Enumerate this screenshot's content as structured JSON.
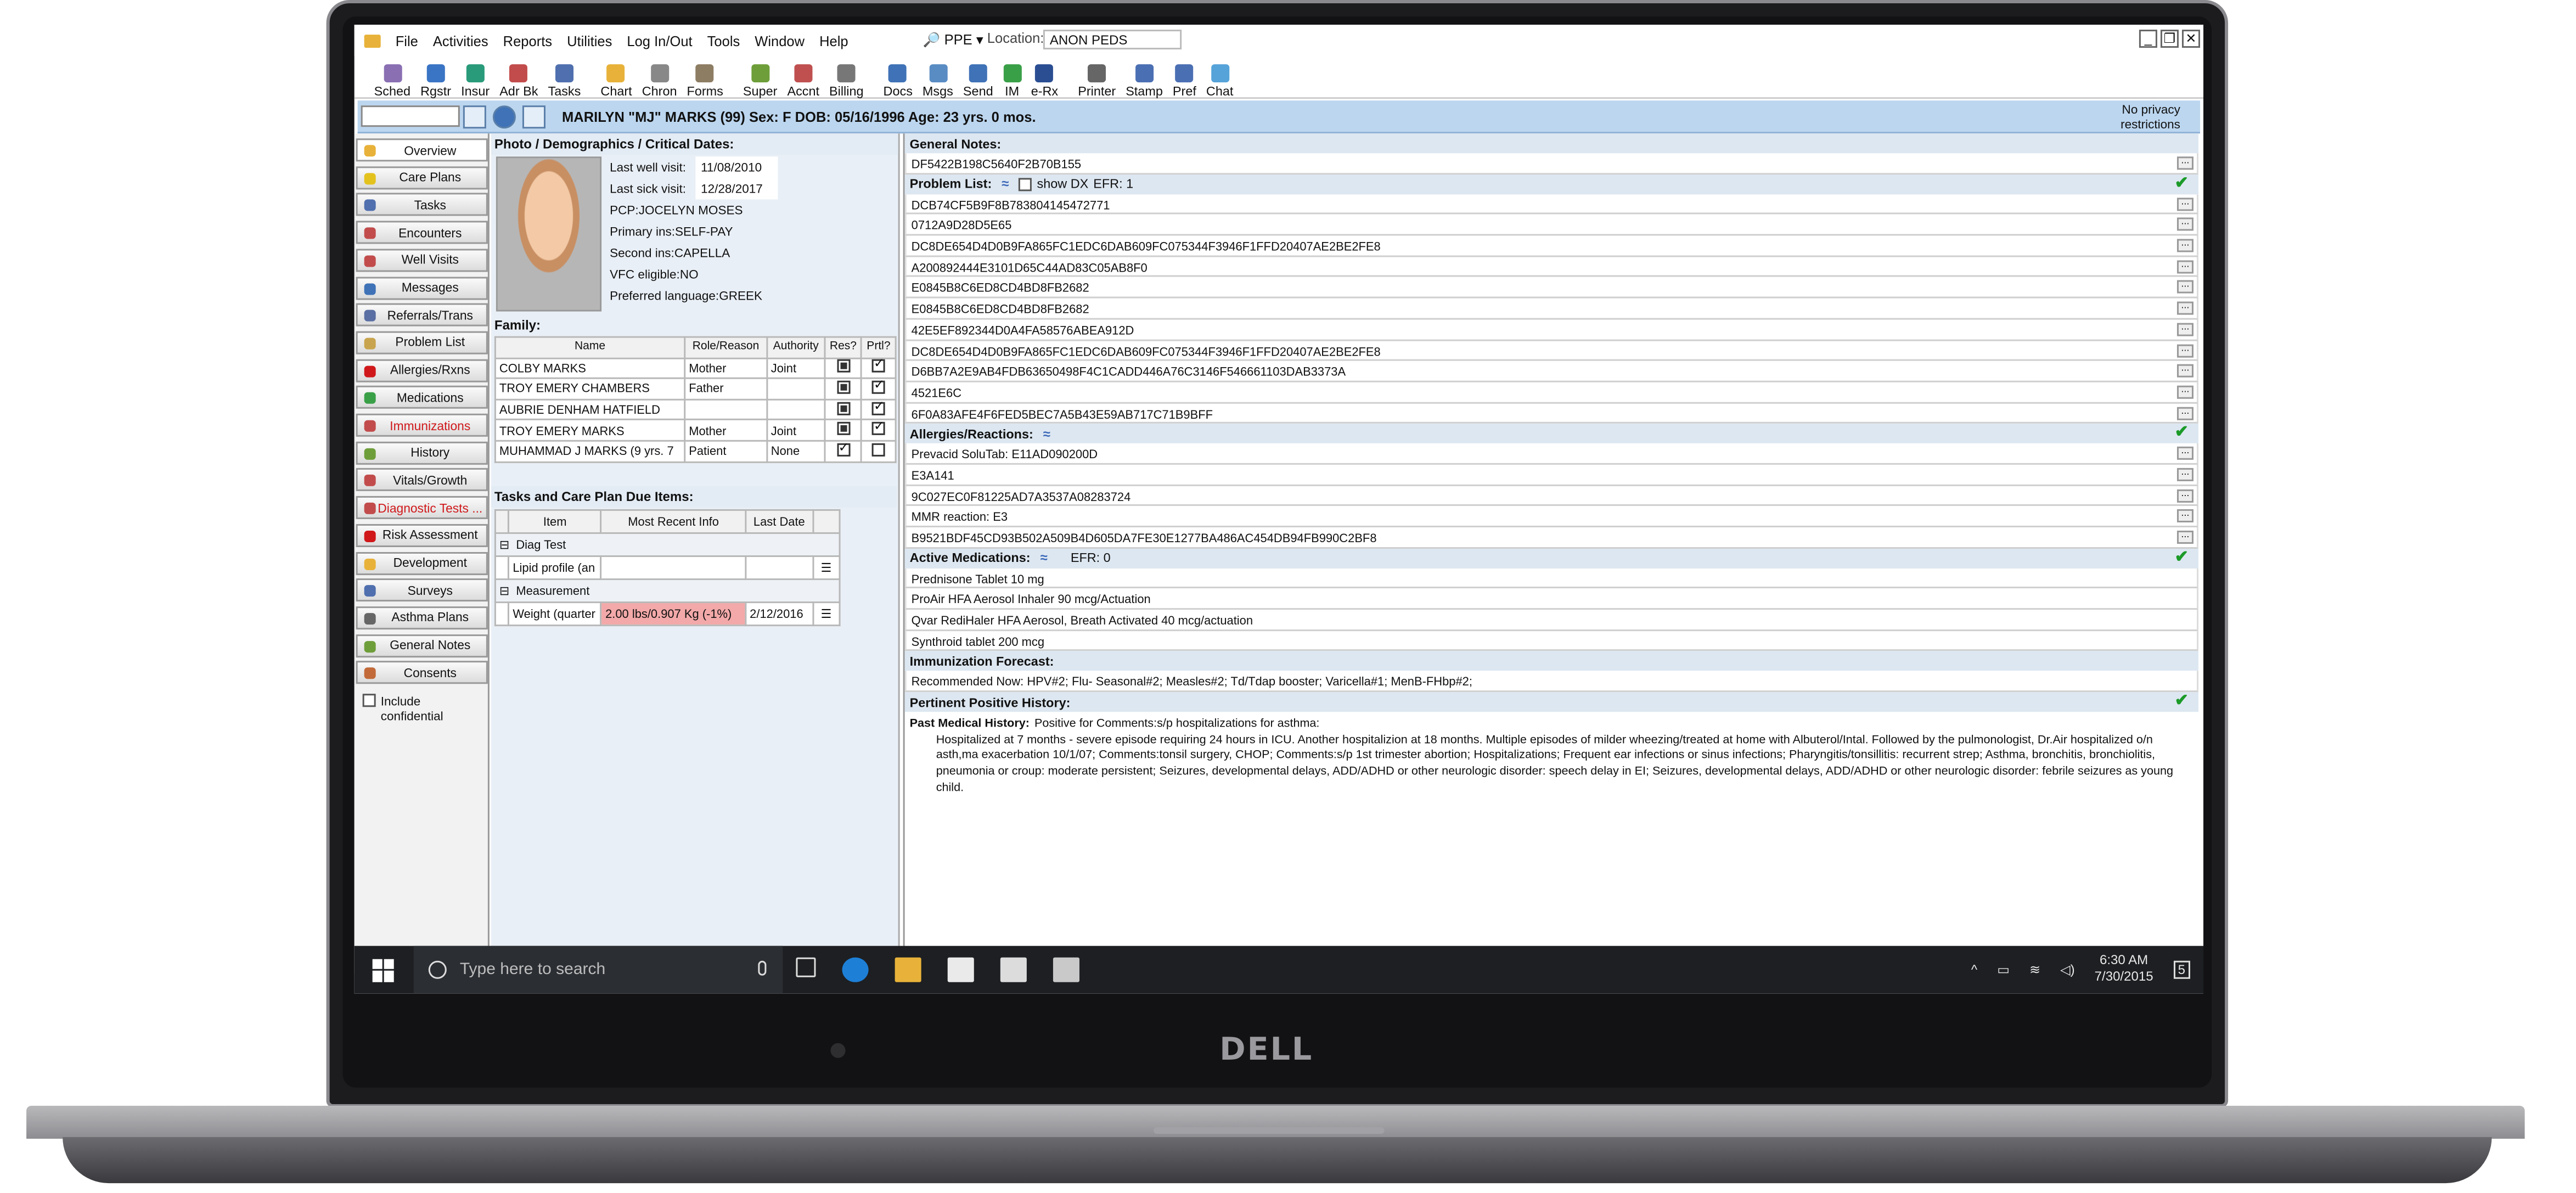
{
  "menu": [
    "File",
    "Activities",
    "Reports",
    "Utilities",
    "Log In/Out",
    "Tools",
    "Window",
    "Help"
  ],
  "ppe": "PPE",
  "location_label": "Location:",
  "location_value": "ANON PEDS",
  "toolbar": [
    {
      "label": "Sched",
      "color": "#8a6fb3"
    },
    {
      "label": "Rgstr",
      "color": "#3a74c4"
    },
    {
      "label": "Insur",
      "color": "#2a9b7a"
    },
    {
      "label": "Adr Bk",
      "color": "#c24c4c"
    },
    {
      "label": "Tasks",
      "color": "#4f6fae"
    },
    {
      "label": "Chart",
      "color": "#e8b23a"
    },
    {
      "label": "Chron",
      "color": "#888888"
    },
    {
      "label": "Forms",
      "color": "#8d7d63"
    },
    {
      "label": "Super",
      "color": "#6e9e3a"
    },
    {
      "label": "Accnt",
      "color": "#c05050"
    },
    {
      "label": "Billing",
      "color": "#777777"
    },
    {
      "label": "Docs",
      "color": "#3f72b7"
    },
    {
      "label": "Msgs",
      "color": "#5a8cc4"
    },
    {
      "label": "Send",
      "color": "#3f72b7"
    },
    {
      "label": "IM",
      "color": "#3aa048"
    },
    {
      "label": "e-Rx",
      "color": "#2b4e93"
    },
    {
      "label": "Printer",
      "color": "#666666"
    },
    {
      "label": "Stamp",
      "color": "#4b6fb3"
    },
    {
      "label": "Pref",
      "color": "#4b6fb3"
    },
    {
      "label": "Chat",
      "color": "#56a3d9"
    }
  ],
  "patient": {
    "banner": "MARILYN \"MJ\" MARKS (99)  Sex: F  DOB: 05/16/1996  Age: 23 yrs. 0 mos.",
    "privacy_line1": "No privacy",
    "privacy_line2": "restrictions"
  },
  "nav": [
    {
      "label": "Overview",
      "color": "#e8b23a"
    },
    {
      "label": "Care Plans",
      "color": "#e3c21e"
    },
    {
      "label": "Tasks",
      "color": "#4f6fae"
    },
    {
      "label": "Encounters",
      "color": "#c24c4c"
    },
    {
      "label": "Well Visits",
      "color": "#c24c4c"
    },
    {
      "label": "Messages",
      "color": "#3f72b7"
    },
    {
      "label": "Referrals/Trans",
      "color": "#5a6fa3"
    },
    {
      "label": "Problem List",
      "color": "#c8a44e"
    },
    {
      "label": "Allergies/Rxns",
      "color": "#d0181b"
    },
    {
      "label": "Medications",
      "color": "#3aa048"
    },
    {
      "label": "Immunizations",
      "color": "#c24c4c",
      "red": true
    },
    {
      "label": "History",
      "color": "#6e9e3a"
    },
    {
      "label": "Vitals/Growth",
      "color": "#c24c4c"
    },
    {
      "label": "Diagnostic Tests ...",
      "color": "#c24c4c",
      "red": true
    },
    {
      "label": "Risk Assessment",
      "color": "#d0181b"
    },
    {
      "label": "Development",
      "color": "#e8b23a"
    },
    {
      "label": "Surveys",
      "color": "#4f6fae"
    },
    {
      "label": "Asthma Plans",
      "color": "#666666"
    },
    {
      "label": "General Notes",
      "color": "#6e9e3a"
    },
    {
      "label": "Consents",
      "color": "#c26a3a"
    }
  ],
  "include_confidential": "Include confidential",
  "photo_section": "Photo / Demographics / Critical Dates:",
  "demographics": [
    {
      "label": "Last well visit:",
      "value": "11/08/2010"
    },
    {
      "label": "Last sick visit:",
      "value": "12/28/2017"
    },
    {
      "label": "PCP:",
      "value": "JOCELYN MOSES"
    },
    {
      "label": "Primary ins:",
      "value": "SELF-PAY"
    },
    {
      "label": "Second ins:",
      "value": "CAPELLA"
    },
    {
      "label": "VFC eligible:",
      "value": "NO"
    },
    {
      "label": "Preferred language:",
      "value": "GREEK"
    }
  ],
  "family_section": "Family:",
  "family_headers": [
    "Name",
    "Role/Reason",
    "Authority",
    "Res?",
    "Prtl?"
  ],
  "family": [
    {
      "name": "COLBY  MARKS",
      "role": "Mother",
      "auth": "Joint",
      "res": "f",
      "prtl": "t"
    },
    {
      "name": "TROY EMERY CHAMBERS",
      "role": "Father",
      "auth": "",
      "res": "f",
      "prtl": "t"
    },
    {
      "name": "AUBRIE DENHAM HATFIELD",
      "role": "",
      "auth": "",
      "res": "f",
      "prtl": "t"
    },
    {
      "name": "TROY EMERY MARKS",
      "role": "Mother",
      "auth": "Joint",
      "res": "f",
      "prtl": "t"
    },
    {
      "name": "MUHAMMAD J MARKS (9 yrs. 7",
      "role": "Patient",
      "auth": "None",
      "res": "t",
      "prtl": "e"
    }
  ],
  "tasks_section": "Tasks and Care Plan Due Items:",
  "tasks_headers": [
    "Item",
    "Most Recent Info",
    "Last Date"
  ],
  "tasks_groups": [
    {
      "group": "Diag Test",
      "item": "Lipid profile (an",
      "info": "",
      "date": ""
    },
    {
      "group": "Measurement",
      "item": "Weight (quarter",
      "info": "2.00 lbs/0.907 Kg (-1%)",
      "date": "2/12/2016"
    }
  ],
  "general_notes": {
    "title": "General Notes:",
    "value": "DF5422B198C5640F2B70B155"
  },
  "problem_list": {
    "title": "Problem List:",
    "show_dx": "show DX",
    "efr": "EFR: 1",
    "items": [
      "DCB74CF5B9F8B783804145472771",
      "0712A9D28D5E65",
      "DC8DE654D4D0B9FA865FC1EDC6DAB609FC075344F3946F1FFD20407AE2BE2FE8",
      "A200892444E3101D65C44AD83C05AB8F0",
      "E0845B8C6ED8CD4BD8FB2682",
      "E0845B8C6ED8CD4BD8FB2682",
      "42E5EF892344D0A4FA58576ABEA912D",
      "DC8DE654D4D0B9FA865FC1EDC6DAB609FC075344F3946F1FFD20407AE2BE2FE8",
      "D6BB7A2E9AB4FDB63650498F4C1CADD446A76C3146F546661103DAB3373A",
      "4521E6C",
      "6F0A83AFE4F6FED5BEC7A5B43E59AB717C71B9BFF"
    ]
  },
  "allergies": {
    "title": "Allergies/Reactions:",
    "items": [
      "Prevacid SoluTab: E11AD090200D",
      "E3A141",
      "9C027EC0F81225AD7A3537A08283724",
      "MMR reaction: E3",
      "B9521BDF45CD93B502A509B4D605DA7FE30E1277BA486AC454DB94FB990C2BF8"
    ]
  },
  "medications": {
    "title": "Active Medications:",
    "efr": "EFR: 0",
    "items": [
      "Prednisone Tablet 10 mg",
      "ProAir HFA Aerosol Inhaler 90 mcg/Actuation",
      "Qvar RediHaler HFA Aerosol, Breath Activated 40 mcg/actuation",
      "Synthroid tablet 200 mcg"
    ]
  },
  "immunization": {
    "title": "Immunization Forecast:",
    "value": "Recommended Now:  HPV#2;  Flu- Seasonal#2;  Measles#2;  Td/Tdap booster;  Varicella#1;  MenB-FHbp#2;"
  },
  "pph": {
    "title": "Pertinent Positive History:",
    "lead_label": "Past Medical History:",
    "lead_text": "Positive for Comments:s/p hospitalizations for asthma:",
    "body": "Hospitalized  at 7 months - severe episode requiring  24 hours in ICU.  Another hospitalizion at 18 months. Multiple episodes of milder wheezing/treated at home with Albuterol/Intal.   Followed by the pulmonologist, Dr.Air hospitalized o/n asth,ma exacerbation 10/1/07; Comments:tonsil surgery, CHOP; Comments:s/p 1st trimester abortion; Hospitalizations; Frequent ear infections or sinus infections; Pharyngitis/tonsillitis: recurrent strep; Asthma, bronchitis, bronchiolitis, pneumonia or croup: moderate persistent; Seizures, developmental delays, ADD/ADHD or other neurologic disorder: speech delay in EI; Seizures, developmental delays, ADD/ADHD or other neurologic disorder: febrile seizures as young child."
  },
  "taskbar": {
    "search_placeholder": "Type here to search",
    "time": "6:30 AM",
    "date": "7/30/2015",
    "notif": "5"
  },
  "brand": "DELL"
}
